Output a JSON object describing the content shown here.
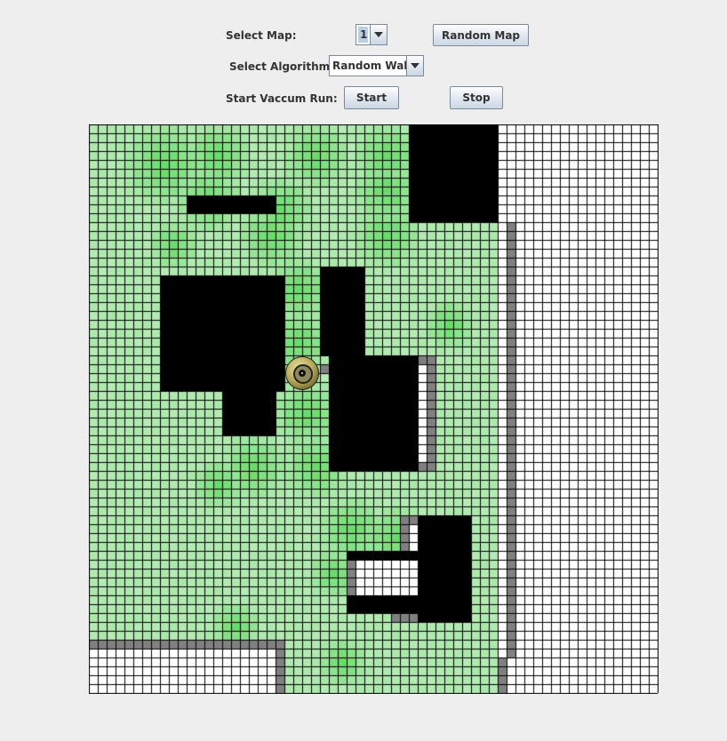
{
  "controls": {
    "select_map_label": "Select Map:",
    "map_value": "1",
    "random_map_label": "Random Map",
    "select_algorithm_label": "Select Algorithm:",
    "algorithm_value": "Random Walk",
    "start_run_label": "Start Vaccum Run:",
    "start_label": "Start",
    "stop_label": "Stop"
  },
  "grid": {
    "columns": 64,
    "rows": 64,
    "colors": {
      "floor_dirty": "#ffffff",
      "floor_clean": "#b3ecb3",
      "floor_clean_heavy": "#66dd66",
      "furniture": "#000000",
      "wall": "#808080",
      "grid_line": "#000000"
    },
    "robot": {
      "icon": "vacuum-robot-icon",
      "col": 23,
      "row": 28
    }
  }
}
